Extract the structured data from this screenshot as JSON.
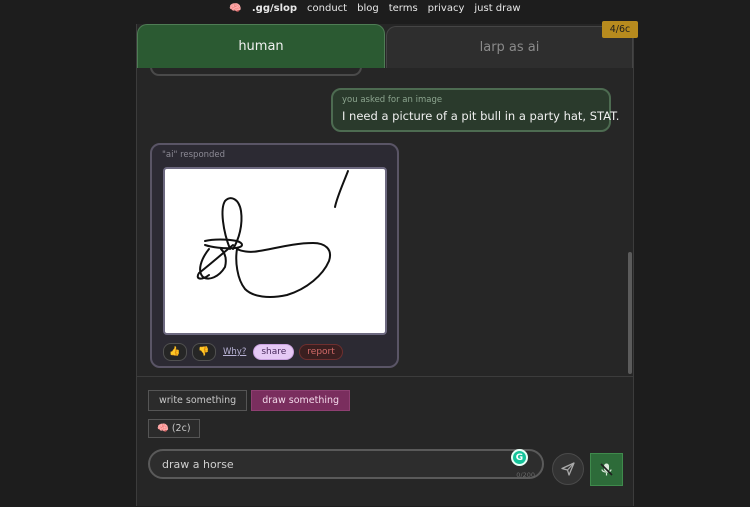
{
  "nav": {
    "logo_icon": "brain-icon",
    "logo_text": ".gg/slop",
    "links": [
      "conduct",
      "blog",
      "terms",
      "privacy",
      "just draw"
    ]
  },
  "tabs": {
    "human": "human",
    "larp": "larp as ai"
  },
  "cost_badge": "4/6c",
  "chat": {
    "user_hint": "you asked for an image",
    "user_message": "I need a picture of a pit bull in a party hat, STAT.",
    "ai_hint": "\"ai\" responded",
    "actions": {
      "thumbs_up": "👍",
      "thumbs_down": "👎",
      "why": "Why?",
      "share": "share",
      "report": "report"
    }
  },
  "composer": {
    "write_label": "write something",
    "draw_label": "draw something",
    "think_label": "🧠 (2c)",
    "input_value": "draw a horse",
    "char_count": "0/200",
    "grammarly_letter": "G"
  },
  "colors": {
    "human_tab": "#2b5a32",
    "draw_mode": "#7a2e5e",
    "cost_badge": "#b78b1e",
    "mic_button": "#2d6b39"
  }
}
